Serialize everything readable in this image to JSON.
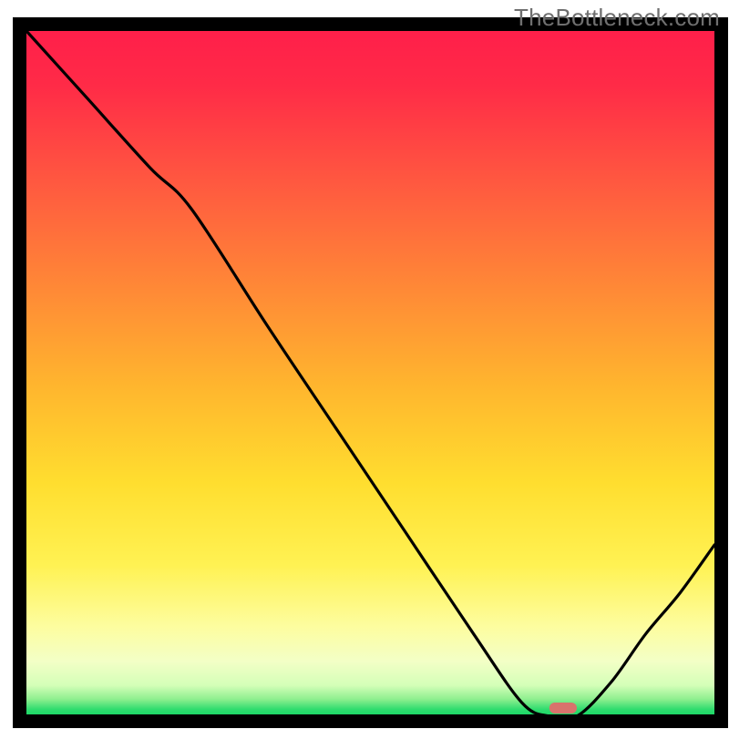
{
  "watermark": "TheBottleneck.com",
  "chart_data": {
    "type": "line",
    "title": "",
    "xlabel": "",
    "ylabel": "",
    "x": [
      0.0,
      0.09,
      0.18,
      0.24,
      0.35,
      0.45,
      0.55,
      0.65,
      0.72,
      0.76,
      0.8,
      0.85,
      0.9,
      0.95,
      1.0
    ],
    "values": [
      1.0,
      0.9,
      0.8,
      0.74,
      0.57,
      0.42,
      0.27,
      0.12,
      0.02,
      0.0,
      0.0,
      0.05,
      0.12,
      0.18,
      0.25
    ],
    "xlim": [
      0,
      1
    ],
    "ylim": [
      0,
      1
    ],
    "optimum_segment": {
      "x0": 0.76,
      "x1": 0.8,
      "y": 0.0
    }
  }
}
